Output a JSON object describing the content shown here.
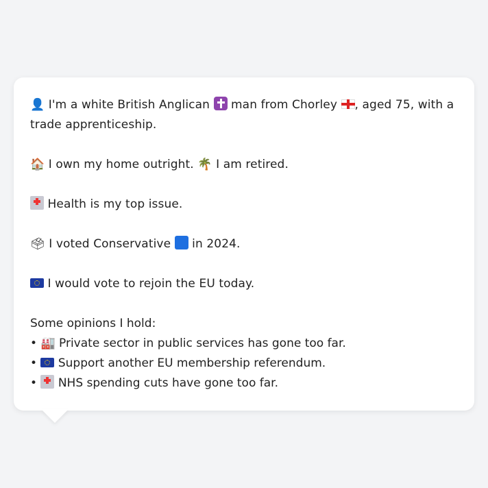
{
  "card": {
    "identity": {
      "icon": "person-silhouette-icon",
      "before_religion": "I'm a white British Anglican",
      "religion_icon": "latin-cross-icon",
      "before_place": "man from Chorley",
      "place_icon": "england-flag-icon",
      "after_place": ", aged 75, with a trade apprenticeship."
    },
    "home": {
      "icon": "house-icon",
      "text1": "I own my home outright.",
      "retired_icon": "palm-tree-icon",
      "text2": "I am retired."
    },
    "issue": {
      "icon": "hospital-icon",
      "text": "Health is my top issue."
    },
    "vote": {
      "icon": "ballot-box-icon",
      "text1": "I voted Conservative",
      "party_icon": "blue-square-icon",
      "party_color": "#1e6fe0",
      "text2": "in 2024."
    },
    "eu": {
      "icon": "eu-flag-icon",
      "text": "I would vote to rejoin the EU today."
    },
    "opinions_heading": "Some opinions I hold:",
    "opinions": [
      {
        "bullet": "•",
        "icon": "factory-icon",
        "text": "Private sector in public services has gone too far."
      },
      {
        "bullet": "•",
        "icon": "eu-flag-icon",
        "text": "Support another EU membership referendum."
      },
      {
        "bullet": "•",
        "icon": "hospital-icon",
        "text": "NHS spending cuts have gone too far."
      }
    ]
  }
}
